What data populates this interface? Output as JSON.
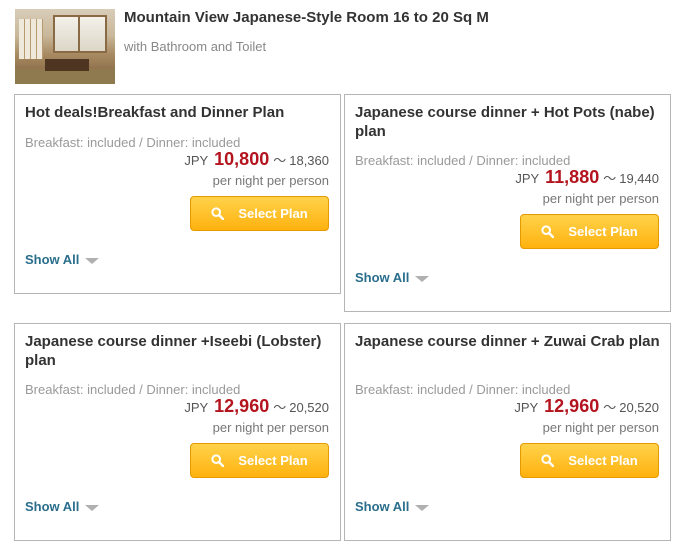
{
  "room": {
    "title": "Mountain View Japanese-Style Room 16 to 20 Sq M",
    "subtitle": "with Bathroom and Toilet"
  },
  "plans": [
    {
      "title": "Hot deals!Breakfast and Dinner Plan",
      "meals": "Breakfast: included / Dinner: included",
      "currency": "JPY",
      "price": "10,800",
      "range_sep": "～",
      "max_price": "18,360",
      "per_night": "per night per person",
      "button_label": "Select Plan",
      "show_all": "Show All"
    },
    {
      "title": "Japanese course dinner + Hot Pots (nabe) plan",
      "meals": "Breakfast: included / Dinner: included",
      "currency": "JPY",
      "price": "11,880",
      "range_sep": "～",
      "max_price": "19,440",
      "per_night": "per night per person",
      "button_label": "Select Plan",
      "show_all": "Show All"
    },
    {
      "title": "Japanese course dinner +Iseebi (Lobster) plan",
      "meals": "Breakfast: included / Dinner: included",
      "currency": "JPY",
      "price": "12,960",
      "range_sep": "～",
      "max_price": "20,520",
      "per_night": "per night per person",
      "button_label": "Select Plan",
      "show_all": "Show All"
    },
    {
      "title": "Japanese course dinner + Zuwai Crab plan",
      "meals": "Breakfast: included / Dinner: included",
      "currency": "JPY",
      "price": "12,960",
      "range_sep": "～",
      "max_price": "20,520",
      "per_night": "per night per person",
      "button_label": "Select Plan",
      "show_all": "Show All"
    }
  ],
  "colors": {
    "price": "#b4141e",
    "button": "#ffb20f",
    "link": "#2a6e8c"
  },
  "icons": {
    "button_icon": "search-icon",
    "show_all_icon": "caret-down-icon"
  }
}
